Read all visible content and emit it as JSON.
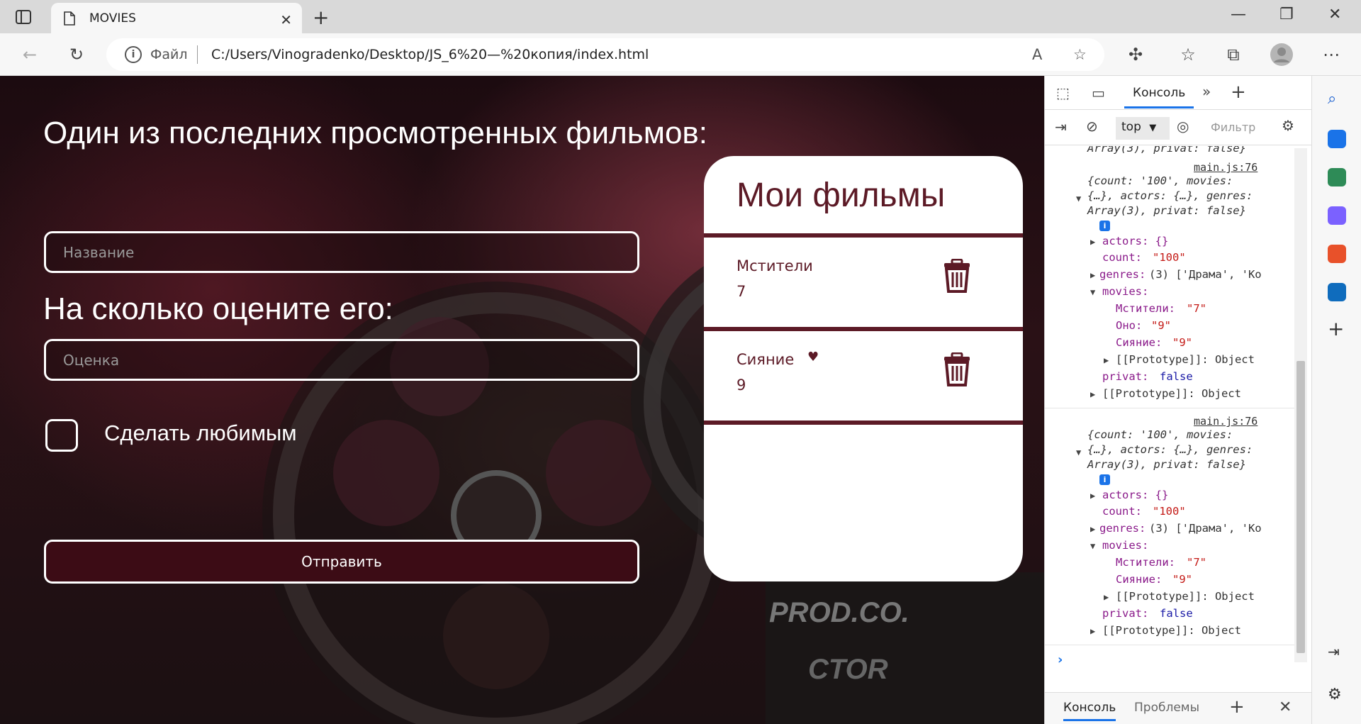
{
  "browser": {
    "tab_title": "MOVIES",
    "address": {
      "file_label": "Файл",
      "url": "C:/Users/Vinogradenko/Desktop/JS_6%20—%20копия/index.html"
    }
  },
  "page": {
    "heading_movie": "Один из последних просмотренных фильмов:",
    "name_placeholder": "Название",
    "heading_rating": "На сколько оцените его:",
    "rating_placeholder": "Оценка",
    "favorite_label": "Сделать любимым",
    "submit_label": "Отправить",
    "card": {
      "title": "Мои фильмы",
      "movies": [
        {
          "name": "Мстители",
          "score": "7",
          "favorite": false
        },
        {
          "name": "Сияние",
          "score": "9",
          "favorite": true
        }
      ]
    },
    "colors": {
      "accent": "#5c1a26",
      "button": "#3c0c15"
    }
  },
  "devtools": {
    "tab_console": "Консоль",
    "context": "top",
    "filter_placeholder": "Фильтр",
    "top_clip": "Array(3), privat: false}",
    "log1": {
      "source": "main.js:76",
      "summary1": "{count: '100', movies:",
      "summary2": "{…}, actors: {…}, genres:",
      "summary3": "Array(3), privat: false}",
      "actors": "actors: {}",
      "count_key": "count:",
      "count_val": "\"100\"",
      "genres_key": "genres:",
      "genres_val": "(3) ['Драма', 'Ко",
      "movies_key": "movies:",
      "m1": "Мстители:",
      "m1v": "\"7\"",
      "m2": "Оно:",
      "m2v": "\"9\"",
      "m3": "Сияние:",
      "m3v": "\"9\"",
      "proto_inner": "[[Prototype]]: Object",
      "privat_key": "privat:",
      "privat_val": "false",
      "proto": "[[Prototype]]: Object"
    },
    "log2": {
      "source": "main.js:76",
      "summary1": "{count: '100', movies:",
      "summary2": "{…}, actors: {…}, genres:",
      "summary3": "Array(3), privat: false}",
      "actors": "actors: {}",
      "count_key": "count:",
      "count_val": "\"100\"",
      "genres_key": "genres:",
      "genres_val": "(3) ['Драма', 'Ко",
      "movies_key": "movies:",
      "m1": "Мстители:",
      "m1v": "\"7\"",
      "m3": "Сияние:",
      "m3v": "\"9\"",
      "proto_inner": "[[Prototype]]: Object",
      "privat_key": "privat:",
      "privat_val": "false",
      "proto": "[[Prototype]]: Object"
    },
    "drawer": {
      "console": "Консоль",
      "issues": "Проблемы"
    }
  }
}
